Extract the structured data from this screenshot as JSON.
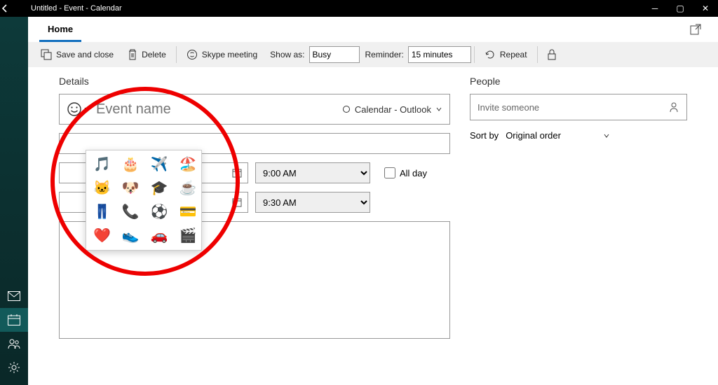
{
  "window": {
    "title": "Untitled - Event - Calendar"
  },
  "tabs": {
    "home": "Home"
  },
  "ribbon": {
    "save_and_close": "Save and close",
    "delete": "Delete",
    "skype_meeting": "Skype meeting",
    "show_as_label": "Show as:",
    "show_as_value": "Busy",
    "reminder_label": "Reminder:",
    "reminder_value": "15 minutes",
    "repeat": "Repeat"
  },
  "details": {
    "heading": "Details",
    "event_name_placeholder": "Event name",
    "calendar_label": "Calendar - Outlook",
    "start_time": "9:00 AM",
    "end_time": "9:30 AM",
    "all_day_label": "All day"
  },
  "people": {
    "heading": "People",
    "invite_placeholder": "Invite someone",
    "sort_by_label": "Sort by",
    "sort_by_value": "Original order"
  },
  "emoji": {
    "items": [
      "🎵",
      "🎂",
      "✈️",
      "🏖️",
      "🐱",
      "🐶",
      "🎓",
      "☕",
      "👖",
      "📞",
      "⚽",
      "💳",
      "❤️",
      "👟",
      "🚗",
      "🎬"
    ]
  }
}
